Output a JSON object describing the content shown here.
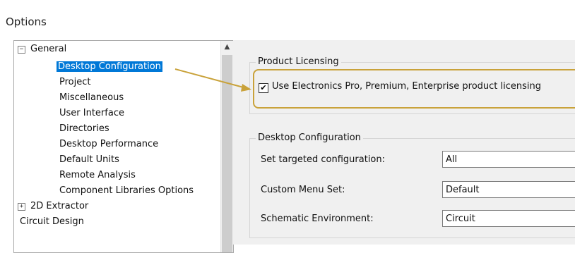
{
  "window": {
    "title": "Options"
  },
  "tree": {
    "items": [
      {
        "label": "General",
        "expander": "−"
      },
      {
        "label": "Desktop Configuration"
      },
      {
        "label": "Project"
      },
      {
        "label": "Miscellaneous"
      },
      {
        "label": "User Interface"
      },
      {
        "label": "Directories"
      },
      {
        "label": "Desktop Performance"
      },
      {
        "label": "Default Units"
      },
      {
        "label": "Remote Analysis"
      },
      {
        "label": "Component Libraries Options"
      },
      {
        "label": "2D Extractor",
        "expander": "+"
      },
      {
        "label": "Circuit Design"
      }
    ],
    "selected": "Desktop Configuration"
  },
  "product_licensing": {
    "title": "Product Licensing",
    "checkbox_label": "Use Electronics Pro, Premium, Enterprise product licensing",
    "checked": true
  },
  "desktop_configuration": {
    "title": "Desktop Configuration",
    "fields": [
      {
        "label": "Set targeted configuration:",
        "value": "All"
      },
      {
        "label": "Custom Menu Set:",
        "value": "Default"
      },
      {
        "label": "Schematic Environment:",
        "value": "Circuit"
      }
    ]
  },
  "colors": {
    "highlight_border": "#c9a23a",
    "selection": "#0078d7"
  }
}
